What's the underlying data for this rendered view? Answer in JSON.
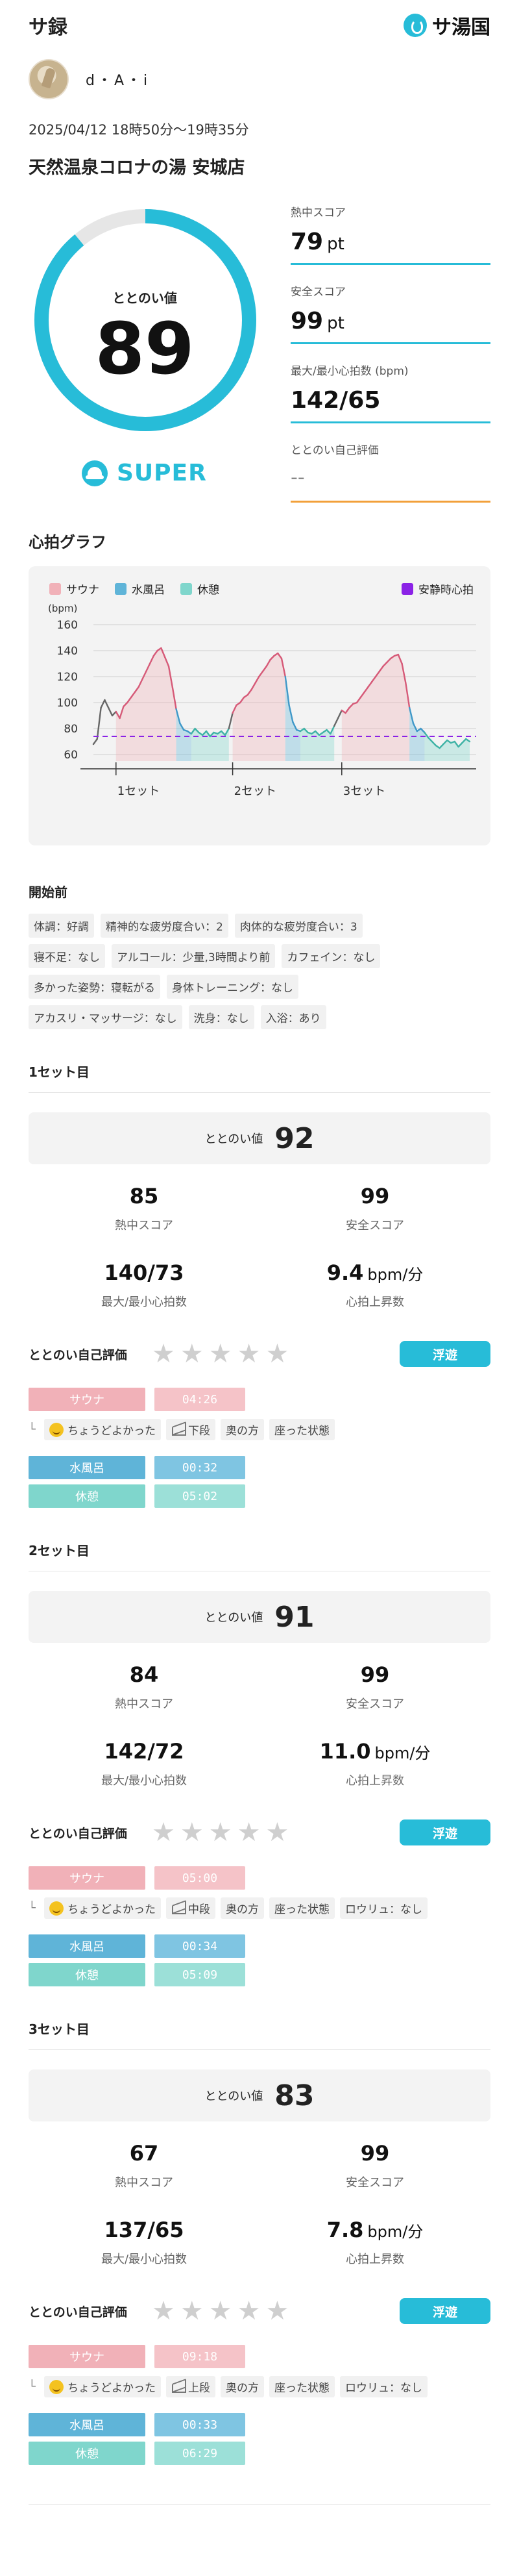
{
  "header": {
    "title": "サ録",
    "brand": "サ湯国",
    "brand_icon": "drop-logo-icon"
  },
  "user": {
    "name": "d・A・i"
  },
  "session": {
    "datetime": "2025/04/12 18時50分〜19時35分",
    "facility": "天然温泉コロナの湯 安城店",
    "totonoi_label": "ととのい値",
    "totonoi_value": "89",
    "totonoi_fraction": 0.89,
    "rank": "SUPER",
    "metrics": [
      {
        "label": "熱中スコア",
        "value": "79",
        "unit": "pt"
      },
      {
        "label": "安全スコア",
        "value": "99",
        "unit": "pt"
      },
      {
        "label": "最大/最小心拍数 (bpm)",
        "value": "142/65",
        "unit": ""
      },
      {
        "label": "ととのい自己評価",
        "value": "--",
        "unit": ""
      }
    ]
  },
  "graph": {
    "title": "心拍グラフ",
    "legend": [
      {
        "label": "サウナ",
        "color": "#f1b1b8"
      },
      {
        "label": "水風呂",
        "color": "#5fb4d8"
      },
      {
        "label": "休憩",
        "color": "#7fd6cc"
      }
    ],
    "resting_label": "安静時心拍",
    "resting_color": "#8b22e6"
  },
  "chart_data": {
    "type": "line",
    "ylabel": "(bpm)",
    "ylim": [
      55,
      165
    ],
    "yticks": [
      60,
      80,
      100,
      120,
      140,
      160
    ],
    "resting_hr": 74,
    "x_labels": [
      "1セット",
      "2セット",
      "3セット"
    ],
    "series": [
      {
        "values": [
          68,
          72,
          96,
          102,
          96,
          90,
          93,
          88,
          97,
          100,
          104,
          108,
          112,
          118,
          124,
          130,
          136,
          140,
          142,
          135,
          128,
          112,
          95,
          84,
          79,
          78,
          76,
          80,
          77,
          75,
          78,
          74,
          77,
          76,
          78,
          75,
          80,
          92,
          98,
          100,
          104,
          106,
          110,
          115,
          120,
          124,
          128,
          133,
          136,
          138,
          134,
          120,
          98,
          85,
          79,
          78,
          80,
          77,
          76,
          78,
          75,
          77,
          79,
          76,
          82,
          88,
          94,
          92,
          96,
          99,
          100,
          104,
          108,
          112,
          116,
          120,
          124,
          128,
          131,
          134,
          136,
          137,
          130,
          115,
          96,
          84,
          78,
          80,
          77,
          73,
          70,
          67,
          65,
          68,
          71,
          69,
          70,
          66,
          69,
          72,
          70
        ]
      }
    ]
  },
  "pre": {
    "title": "開始前",
    "tags": [
      "体調：好調",
      "精神的な疲労度合い：2",
      "肉体的な疲労度合い：3",
      "寝不足：なし",
      "アルコール：少量,3時間より前",
      "カフェイン：なし",
      "多かった姿勢：寝転がる",
      "身体トレーニング：なし",
      "アカスリ・マッサージ：なし",
      "洗身：なし",
      "入浴：あり"
    ]
  },
  "sets": [
    {
      "title": "1セット目",
      "totonoi_label": "ととのい値",
      "totonoi_value": "92",
      "heat": "85",
      "heat_label": "熱中スコア",
      "safe": "99",
      "safe_label": "安全スコア",
      "hr": "140/73",
      "hr_label": "最大/最小心拍数",
      "rise": "9.4",
      "rise_unit": "bpm/分",
      "rise_label": "心拍上昇数",
      "eval_label": "ととのい自己評価",
      "stars": 0,
      "float_label": "浮遊",
      "sauna_label": "サウナ",
      "sauna_time": "04:26",
      "notes": [
        "ちょうどよかった",
        "下段",
        "奥の方",
        "座った状態"
      ],
      "water_label": "水風呂",
      "water_time": "00:32",
      "rest_label": "休憩",
      "rest_time": "05:02"
    },
    {
      "title": "2セット目",
      "totonoi_label": "ととのい値",
      "totonoi_value": "91",
      "heat": "84",
      "heat_label": "熱中スコア",
      "safe": "99",
      "safe_label": "安全スコア",
      "hr": "142/72",
      "hr_label": "最大/最小心拍数",
      "rise": "11.0",
      "rise_unit": "bpm/分",
      "rise_label": "心拍上昇数",
      "eval_label": "ととのい自己評価",
      "stars": 0,
      "float_label": "浮遊",
      "sauna_label": "サウナ",
      "sauna_time": "05:00",
      "notes": [
        "ちょうどよかった",
        "中段",
        "奥の方",
        "座った状態",
        "ロウリュ：なし"
      ],
      "water_label": "水風呂",
      "water_time": "00:34",
      "rest_label": "休憩",
      "rest_time": "05:09"
    },
    {
      "title": "3セット目",
      "totonoi_label": "ととのい値",
      "totonoi_value": "83",
      "heat": "67",
      "heat_label": "熱中スコア",
      "safe": "99",
      "safe_label": "安全スコア",
      "hr": "137/65",
      "hr_label": "最大/最小心拍数",
      "rise": "7.8",
      "rise_unit": "bpm/分",
      "rise_label": "心拍上昇数",
      "eval_label": "ととのい自己評価",
      "stars": 0,
      "float_label": "浮遊",
      "sauna_label": "サウナ",
      "sauna_time": "09:18",
      "notes": [
        "ちょうどよかった",
        "上段",
        "奥の方",
        "座った状態",
        "ロウリュ：なし"
      ],
      "water_label": "水風呂",
      "water_time": "00:33",
      "rest_label": "休憩",
      "rest_time": "06:29"
    }
  ]
}
